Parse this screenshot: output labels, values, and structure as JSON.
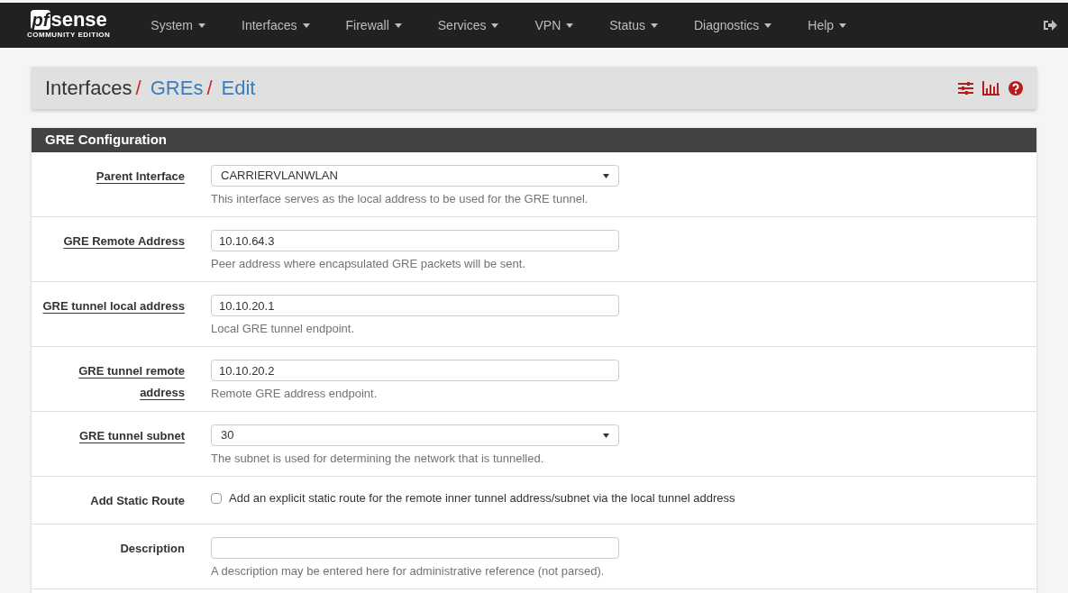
{
  "logo": {
    "mark": "pf",
    "word": "sense",
    "edition": "COMMUNITY EDITION"
  },
  "nav": [
    {
      "label": "System"
    },
    {
      "label": "Interfaces"
    },
    {
      "label": "Firewall"
    },
    {
      "label": "Services"
    },
    {
      "label": "VPN"
    },
    {
      "label": "Status"
    },
    {
      "label": "Diagnostics"
    },
    {
      "label": "Help"
    }
  ],
  "breadcrumb": [
    {
      "label": "Interfaces",
      "link": false,
      "separator": "/"
    },
    {
      "label": "GREs",
      "link": true,
      "separator": "/"
    },
    {
      "label": "Edit",
      "link": true
    }
  ],
  "panel": {
    "title": "GRE Configuration"
  },
  "fields": [
    {
      "kind": "select",
      "label": "Parent Interface",
      "required": true,
      "value": "CARRIERVLANWLAN",
      "help": "This interface serves as the local address to be used for the GRE tunnel."
    },
    {
      "kind": "text",
      "label": "GRE Remote Address",
      "required": true,
      "value": "10.10.64.3",
      "help": "Peer address where encapsulated GRE packets will be sent."
    },
    {
      "kind": "text",
      "label": "GRE tunnel local address",
      "required": true,
      "value": "10.10.20.1",
      "help": "Local GRE tunnel endpoint."
    },
    {
      "kind": "text",
      "label": "GRE tunnel remote address",
      "required": true,
      "value": "10.10.20.2",
      "help": "Remote GRE address endpoint."
    },
    {
      "kind": "select",
      "label": "GRE tunnel subnet",
      "required": true,
      "value": "30",
      "help": "The subnet is used for determining the network that is tunnelled."
    },
    {
      "kind": "checkbox",
      "label": "Add Static Route",
      "required": false,
      "checked": false,
      "text": "Add an explicit static route for the remote inner tunnel address/subnet via the local tunnel address"
    },
    {
      "kind": "text",
      "label": "Description",
      "required": false,
      "help": "A description may be entered here for administrative reference (not parsed)."
    }
  ]
}
